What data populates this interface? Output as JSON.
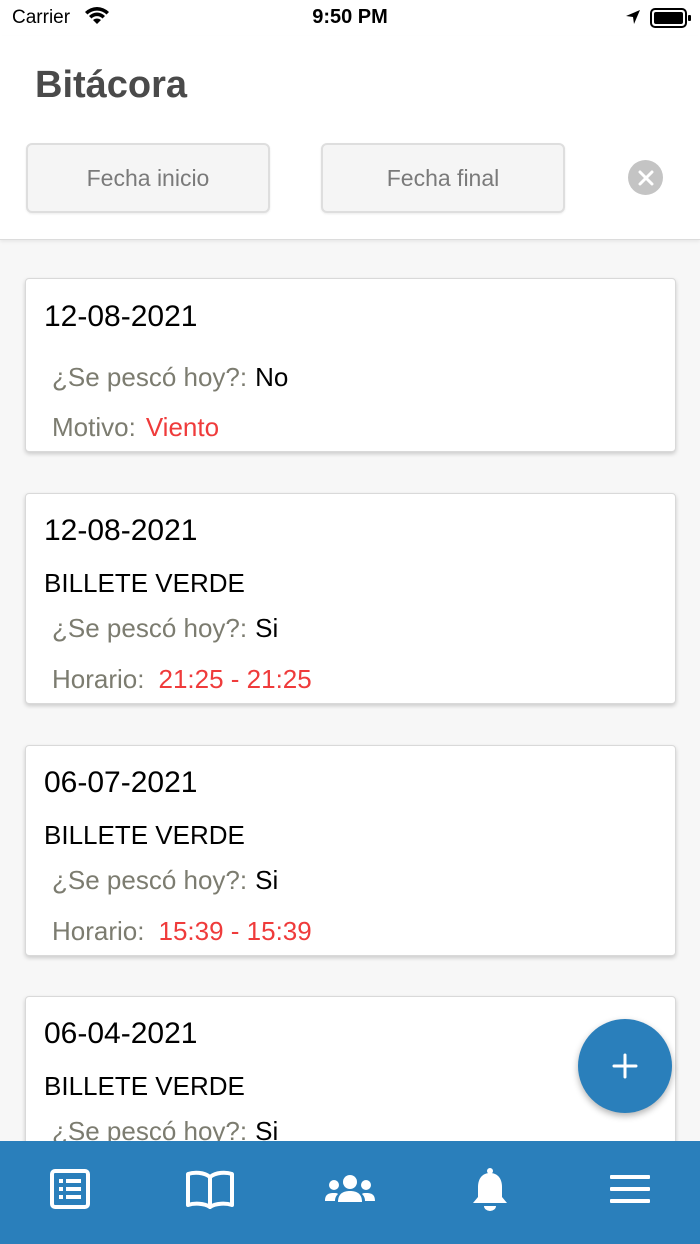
{
  "status_bar": {
    "carrier": "Carrier",
    "time": "9:50 PM"
  },
  "header": {
    "title": "Bitácora",
    "start_date_placeholder": "Fecha inicio",
    "end_date_placeholder": "Fecha final"
  },
  "entries": [
    {
      "date": "12-08-2021",
      "product": "",
      "fished_label": "¿Se pescó hoy?:",
      "fished_value": "No",
      "detail_label": "Motivo:",
      "detail_value": "Viento"
    },
    {
      "date": "12-08-2021",
      "product": "BILLETE VERDE",
      "fished_label": "¿Se pescó hoy?:",
      "fished_value": "Si",
      "detail_label": "Horario:",
      "detail_value": "21:25 - 21:25"
    },
    {
      "date": "06-07-2021",
      "product": "BILLETE VERDE",
      "fished_label": "¿Se pescó hoy?:",
      "fished_value": "Si",
      "detail_label": "Horario:",
      "detail_value": "15:39 - 15:39"
    },
    {
      "date": "06-04-2021",
      "product": "BILLETE VERDE",
      "fished_label": "¿Se pescó hoy?:",
      "fished_value": "Si",
      "detail_label": "",
      "detail_value": ""
    }
  ],
  "fab": {
    "icon": "plus-icon"
  },
  "tabs": [
    {
      "icon": "log-list-icon",
      "active": true
    },
    {
      "icon": "book-icon",
      "active": false
    },
    {
      "icon": "users-icon",
      "active": false
    },
    {
      "icon": "bell-icon",
      "active": false
    },
    {
      "icon": "menu-icon",
      "active": false
    }
  ],
  "colors": {
    "primary": "#2a7fbb",
    "accent_red": "#ef3b3b",
    "label_gray": "#7c7c70"
  }
}
